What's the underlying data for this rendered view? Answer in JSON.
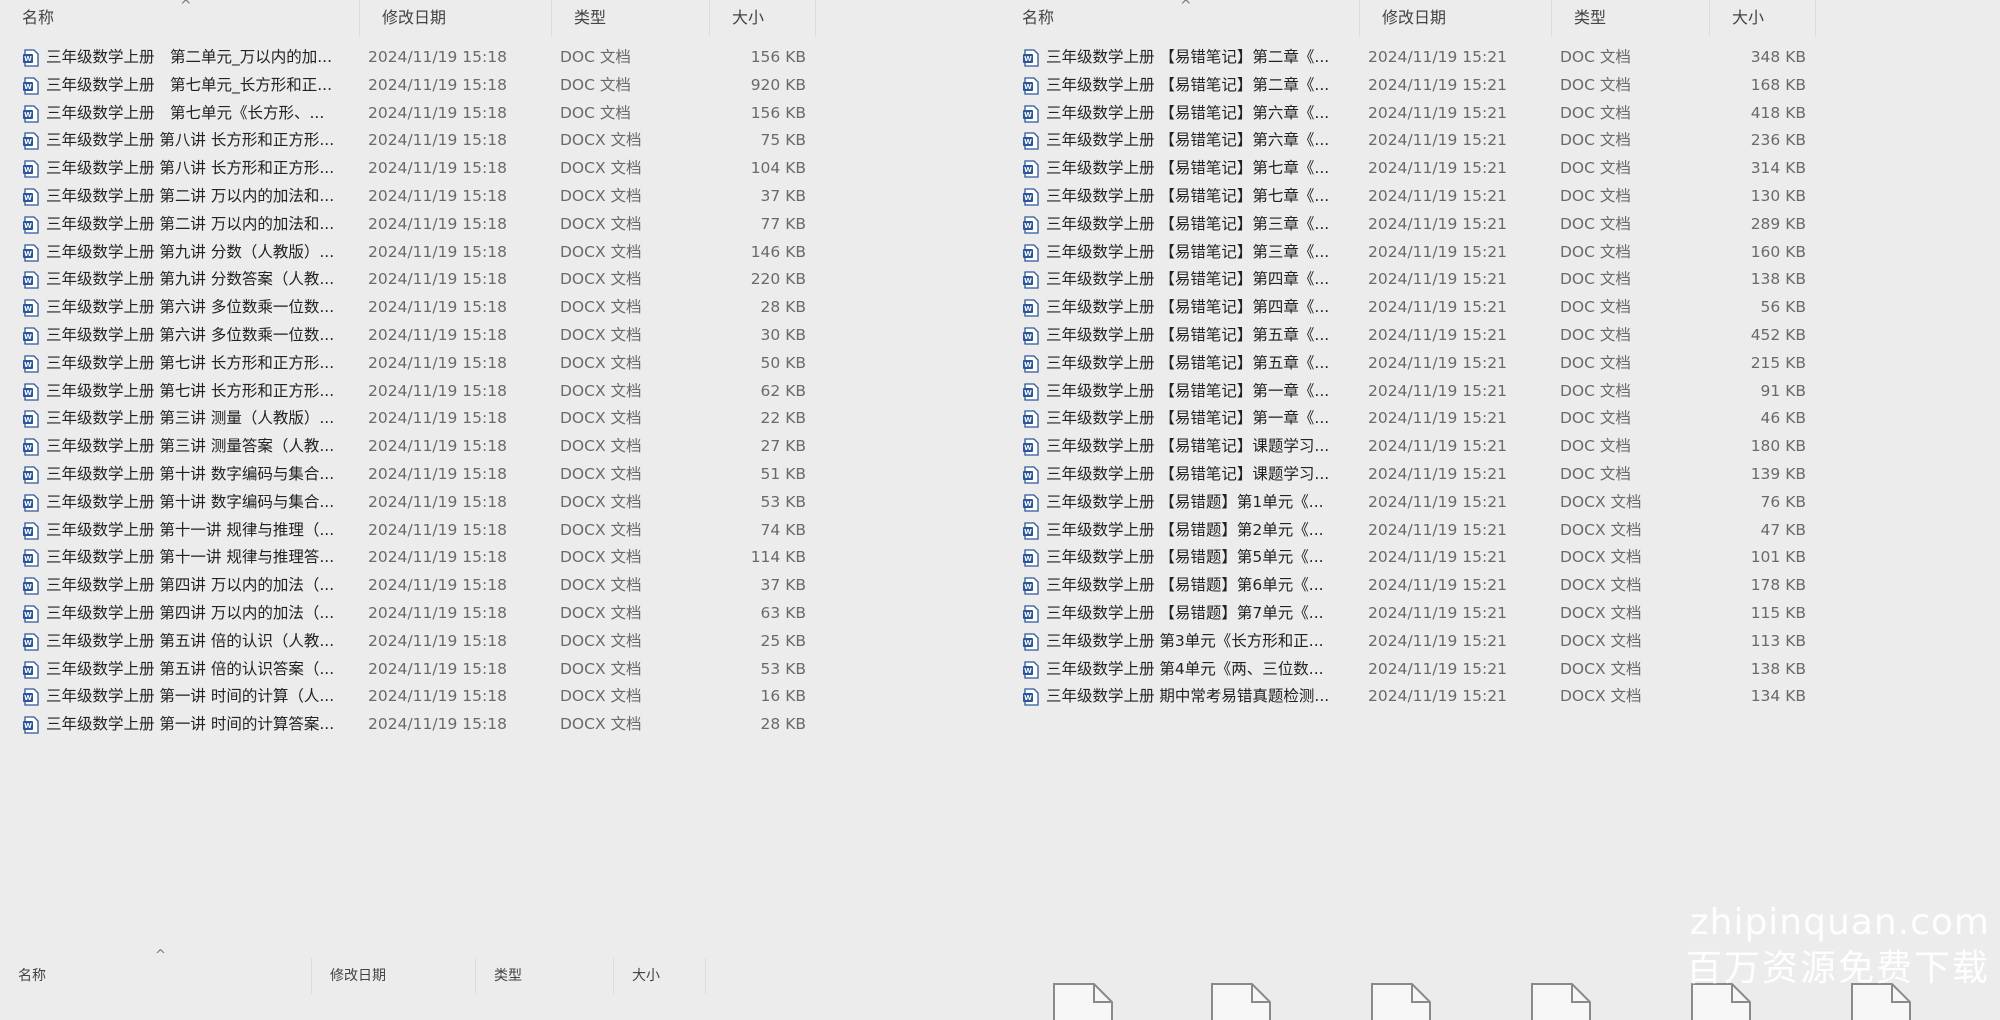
{
  "columns": {
    "name": "名称",
    "date": "修改日期",
    "type": "类型",
    "size": "大小",
    "sort_glyph": "^"
  },
  "icons": {
    "file": "word-doc-icon",
    "sort": "sort-ascending-icon",
    "blank_file": "blank-file-icon"
  },
  "left_files": [
    {
      "name": "三年级数学上册　第二单元_万以内的加...",
      "date": "2024/11/19 15:18",
      "type": "DOC 文档",
      "size": "156 KB"
    },
    {
      "name": "三年级数学上册　第七单元_长方形和正...",
      "date": "2024/11/19 15:18",
      "type": "DOC 文档",
      "size": "920 KB"
    },
    {
      "name": "三年级数学上册　第七单元《长方形、...",
      "date": "2024/11/19 15:18",
      "type": "DOC 文档",
      "size": "156 KB"
    },
    {
      "name": "三年级数学上册 第八讲 长方形和正方形...",
      "date": "2024/11/19 15:18",
      "type": "DOCX 文档",
      "size": "75 KB"
    },
    {
      "name": "三年级数学上册 第八讲 长方形和正方形...",
      "date": "2024/11/19 15:18",
      "type": "DOCX 文档",
      "size": "104 KB"
    },
    {
      "name": "三年级数学上册 第二讲 万以内的加法和...",
      "date": "2024/11/19 15:18",
      "type": "DOCX 文档",
      "size": "37 KB"
    },
    {
      "name": "三年级数学上册 第二讲 万以内的加法和...",
      "date": "2024/11/19 15:18",
      "type": "DOCX 文档",
      "size": "77 KB"
    },
    {
      "name": "三年级数学上册 第九讲 分数（人教版）...",
      "date": "2024/11/19 15:18",
      "type": "DOCX 文档",
      "size": "146 KB"
    },
    {
      "name": "三年级数学上册 第九讲 分数答案（人教...",
      "date": "2024/11/19 15:18",
      "type": "DOCX 文档",
      "size": "220 KB"
    },
    {
      "name": "三年级数学上册 第六讲 多位数乘一位数...",
      "date": "2024/11/19 15:18",
      "type": "DOCX 文档",
      "size": "28 KB"
    },
    {
      "name": "三年级数学上册 第六讲 多位数乘一位数...",
      "date": "2024/11/19 15:18",
      "type": "DOCX 文档",
      "size": "30 KB"
    },
    {
      "name": "三年级数学上册 第七讲 长方形和正方形...",
      "date": "2024/11/19 15:18",
      "type": "DOCX 文档",
      "size": "50 KB"
    },
    {
      "name": "三年级数学上册 第七讲 长方形和正方形...",
      "date": "2024/11/19 15:18",
      "type": "DOCX 文档",
      "size": "62 KB"
    },
    {
      "name": "三年级数学上册 第三讲 测量（人教版）...",
      "date": "2024/11/19 15:18",
      "type": "DOCX 文档",
      "size": "22 KB"
    },
    {
      "name": "三年级数学上册 第三讲 测量答案（人教...",
      "date": "2024/11/19 15:18",
      "type": "DOCX 文档",
      "size": "27 KB"
    },
    {
      "name": "三年级数学上册 第十讲 数字编码与集合...",
      "date": "2024/11/19 15:18",
      "type": "DOCX 文档",
      "size": "51 KB"
    },
    {
      "name": "三年级数学上册 第十讲 数字编码与集合...",
      "date": "2024/11/19 15:18",
      "type": "DOCX 文档",
      "size": "53 KB"
    },
    {
      "name": "三年级数学上册 第十一讲 规律与推理（...",
      "date": "2024/11/19 15:18",
      "type": "DOCX 文档",
      "size": "74 KB"
    },
    {
      "name": "三年级数学上册 第十一讲 规律与推理答...",
      "date": "2024/11/19 15:18",
      "type": "DOCX 文档",
      "size": "114 KB"
    },
    {
      "name": "三年级数学上册 第四讲 万以内的加法（...",
      "date": "2024/11/19 15:18",
      "type": "DOCX 文档",
      "size": "37 KB"
    },
    {
      "name": "三年级数学上册 第四讲 万以内的加法（...",
      "date": "2024/11/19 15:18",
      "type": "DOCX 文档",
      "size": "63 KB"
    },
    {
      "name": "三年级数学上册 第五讲 倍的认识（人教...",
      "date": "2024/11/19 15:18",
      "type": "DOCX 文档",
      "size": "25 KB"
    },
    {
      "name": "三年级数学上册 第五讲 倍的认识答案（...",
      "date": "2024/11/19 15:18",
      "type": "DOCX 文档",
      "size": "53 KB"
    },
    {
      "name": "三年级数学上册 第一讲 时间的计算（人...",
      "date": "2024/11/19 15:18",
      "type": "DOCX 文档",
      "size": "16 KB"
    },
    {
      "name": "三年级数学上册 第一讲 时间的计算答案...",
      "date": "2024/11/19 15:18",
      "type": "DOCX 文档",
      "size": "28 KB"
    }
  ],
  "right_files": [
    {
      "name": "三年级数学上册 【易错笔记】第二章《...",
      "date": "2024/11/19 15:21",
      "type": "DOC 文档",
      "size": "348 KB"
    },
    {
      "name": "三年级数学上册 【易错笔记】第二章《...",
      "date": "2024/11/19 15:21",
      "type": "DOC 文档",
      "size": "168 KB"
    },
    {
      "name": "三年级数学上册 【易错笔记】第六章《...",
      "date": "2024/11/19 15:21",
      "type": "DOC 文档",
      "size": "418 KB"
    },
    {
      "name": "三年级数学上册 【易错笔记】第六章《...",
      "date": "2024/11/19 15:21",
      "type": "DOC 文档",
      "size": "236 KB"
    },
    {
      "name": "三年级数学上册 【易错笔记】第七章《...",
      "date": "2024/11/19 15:21",
      "type": "DOC 文档",
      "size": "314 KB"
    },
    {
      "name": "三年级数学上册 【易错笔记】第七章《...",
      "date": "2024/11/19 15:21",
      "type": "DOC 文档",
      "size": "130 KB"
    },
    {
      "name": "三年级数学上册 【易错笔记】第三章《...",
      "date": "2024/11/19 15:21",
      "type": "DOC 文档",
      "size": "289 KB"
    },
    {
      "name": "三年级数学上册 【易错笔记】第三章《...",
      "date": "2024/11/19 15:21",
      "type": "DOC 文档",
      "size": "160 KB"
    },
    {
      "name": "三年级数学上册 【易错笔记】第四章《...",
      "date": "2024/11/19 15:21",
      "type": "DOC 文档",
      "size": "138 KB"
    },
    {
      "name": "三年级数学上册 【易错笔记】第四章《...",
      "date": "2024/11/19 15:21",
      "type": "DOC 文档",
      "size": "56 KB"
    },
    {
      "name": "三年级数学上册 【易错笔记】第五章《...",
      "date": "2024/11/19 15:21",
      "type": "DOC 文档",
      "size": "452 KB"
    },
    {
      "name": "三年级数学上册 【易错笔记】第五章《...",
      "date": "2024/11/19 15:21",
      "type": "DOC 文档",
      "size": "215 KB"
    },
    {
      "name": "三年级数学上册 【易错笔记】第一章《...",
      "date": "2024/11/19 15:21",
      "type": "DOC 文档",
      "size": "91 KB"
    },
    {
      "name": "三年级数学上册 【易错笔记】第一章《...",
      "date": "2024/11/19 15:21",
      "type": "DOC 文档",
      "size": "46 KB"
    },
    {
      "name": "三年级数学上册 【易错笔记】课题学习...",
      "date": "2024/11/19 15:21",
      "type": "DOC 文档",
      "size": "180 KB"
    },
    {
      "name": "三年级数学上册 【易错笔记】课题学习...",
      "date": "2024/11/19 15:21",
      "type": "DOC 文档",
      "size": "139 KB"
    },
    {
      "name": "三年级数学上册 【易错题】第1单元《...",
      "date": "2024/11/19 15:21",
      "type": "DOCX 文档",
      "size": "76 KB"
    },
    {
      "name": "三年级数学上册 【易错题】第2单元《...",
      "date": "2024/11/19 15:21",
      "type": "DOCX 文档",
      "size": "47 KB"
    },
    {
      "name": "三年级数学上册 【易错题】第5单元《...",
      "date": "2024/11/19 15:21",
      "type": "DOCX 文档",
      "size": "101 KB"
    },
    {
      "name": "三年级数学上册 【易错题】第6单元《...",
      "date": "2024/11/19 15:21",
      "type": "DOCX 文档",
      "size": "178 KB"
    },
    {
      "name": "三年级数学上册 【易错题】第7单元《...",
      "date": "2024/11/19 15:21",
      "type": "DOCX 文档",
      "size": "115 KB"
    },
    {
      "name": "三年级数学上册 第3单元《长方形和正...",
      "date": "2024/11/19 15:21",
      "type": "DOCX 文档",
      "size": "113 KB"
    },
    {
      "name": "三年级数学上册 第4单元《两、三位数...",
      "date": "2024/11/19 15:21",
      "type": "DOCX 文档",
      "size": "138 KB"
    },
    {
      "name": "三年级数学上册 期中常考易错真题检测...",
      "date": "2024/11/19 15:21",
      "type": "DOCX 文档",
      "size": "134 KB"
    }
  ],
  "watermark": {
    "line1": "zhipinquan.com",
    "line2": "百万资源免费下载"
  },
  "colors": {
    "background": "#ececec",
    "icon_blue": "#2b579a",
    "text": "#2b2b2b",
    "muted": "#6a6a6a"
  }
}
